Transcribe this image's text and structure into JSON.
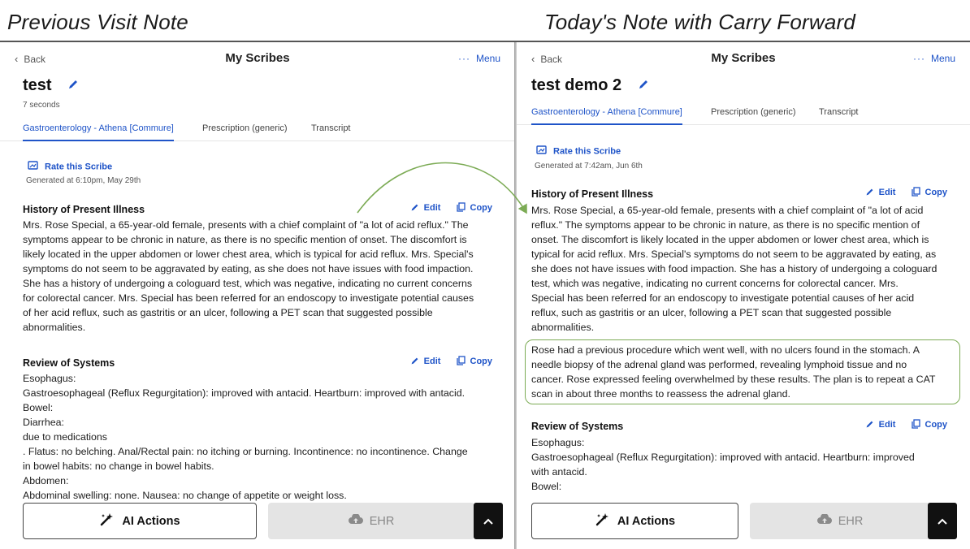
{
  "captions": {
    "left": "Previous Visit Note",
    "right": "Today's Note with Carry Forward"
  },
  "colors": {
    "accent": "#1f54c8",
    "highlight_border": "#7cab55",
    "arrow": "#7cab55",
    "ehr_disabled_bg": "#e4e4e4"
  },
  "left": {
    "nav": {
      "back": "Back",
      "title": "My Scribes",
      "menu": "Menu"
    },
    "note_title": "test",
    "duration": "7 seconds",
    "tabs": [
      "Gastroenterology - Athena [Commure]",
      "Prescription (generic)",
      "Transcript"
    ],
    "active_tab": "Gastroenterology - Athena [Commure]",
    "rate_label": "Rate this Scribe",
    "generated": "Generated at 6:10pm, May 29th",
    "sections": [
      {
        "title": "History of Present Illness",
        "edit": "Edit",
        "copy": "Copy",
        "lines": [
          "Mrs. Rose Special, a 65-year-old female, presents with a chief complaint of \"a lot of acid reflux.\" The",
          "symptoms appear to be chronic in nature, as there is no specific mention of onset. The discomfort is",
          "likely located in the upper abdomen or lower chest area, which is typical for acid reflux. Mrs. Special's",
          "symptoms do not seem to be aggravated by eating, as she does not have issues with food impaction.",
          "She has a history of undergoing a cologuard test, which was negative, indicating no current concerns",
          "for colorectal cancer. Mrs. Special has been referred for an endoscopy to investigate potential causes",
          "of her acid reflux, such as gastritis or an ulcer, following a PET scan that suggested possible",
          "abnormalities."
        ]
      },
      {
        "title": "Review of Systems",
        "edit": "Edit",
        "copy": "Copy",
        "lines": [
          "Esophagus:",
          "Gastroesophageal (Reflux Regurgitation): improved with antacid. Heartburn: improved with antacid.",
          "Bowel:",
          "Diarrhea:",
          "due to medications",
          ". Flatus: no belching. Anal/Rectal pain: no itching or burning. Incontinence: no incontinence. Change",
          "in bowel habits: no change in bowel habits.",
          "Abdomen:",
          "Abdominal swelling: none. Nausea: no change of appetite or weight loss."
        ]
      }
    ],
    "buttons": {
      "ai_actions": "AI Actions",
      "ehr": "EHR"
    }
  },
  "right": {
    "nav": {
      "back": "Back",
      "title": "My Scribes",
      "menu": "Menu"
    },
    "note_title": "test demo 2",
    "tabs": [
      "Gastroenterology - Athena [Commure]",
      "Prescription (generic)",
      "Transcript"
    ],
    "active_tab": "Gastroenterology - Athena [Commure]",
    "rate_label": "Rate this Scribe",
    "generated": "Generated at 7:42am, Jun 6th",
    "sections": [
      {
        "title": "History of Present Illness",
        "edit": "Edit",
        "copy": "Copy",
        "lines": [
          "Mrs. Rose Special, a 65-year-old female, presents with a chief complaint of \"a lot of acid",
          "reflux.\" The symptoms appear to be chronic in nature, as there is no specific mention of",
          "onset. The discomfort is likely located in the upper abdomen or lower chest area, which is",
          "typical for acid reflux. Mrs. Special's symptoms do not seem to be aggravated by eating, as",
          "she does not have issues with food impaction. She has a history of undergoing a cologuard",
          "test, which was negative, indicating no current concerns for colorectal cancer. Mrs.",
          "Special has been referred for an endoscopy to investigate potential causes of her acid",
          "reflux, such as gastritis or an ulcer, following a PET scan that suggested possible",
          "abnormalities."
        ],
        "carry_forward_lines": [
          "Rose had a previous procedure which went well, with no ulcers found in the stomach. A",
          "needle biopsy of the adrenal gland was performed, revealing lymphoid tissue and no",
          "cancer. Rose expressed feeling overwhelmed by these results. The plan is to repeat a CAT",
          "scan in about three months to reassess the adrenal gland."
        ]
      },
      {
        "title": "Review of Systems",
        "edit": "Edit",
        "copy": "Copy",
        "lines": [
          "Esophagus:",
          "Gastroesophageal (Reflux Regurgitation): improved with antacid. Heartburn: improved",
          "with antacid.",
          "Bowel:"
        ]
      }
    ],
    "buttons": {
      "ai_actions": "AI Actions",
      "ehr": "EHR"
    }
  }
}
